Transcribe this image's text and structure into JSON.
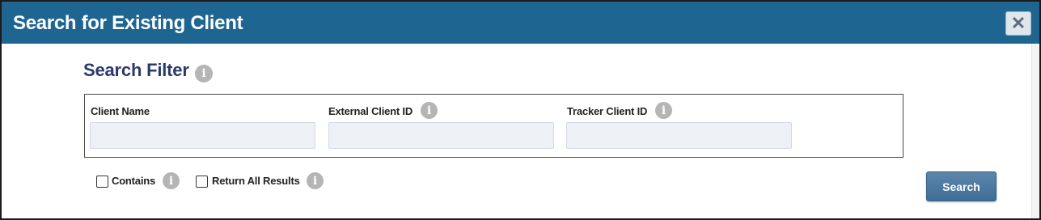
{
  "dialog": {
    "title": "Search for Existing Client",
    "close_symbol": "✕"
  },
  "filter": {
    "section_title": "Search Filter",
    "fields": [
      {
        "label": "Client Name",
        "value": "",
        "placeholder": ""
      },
      {
        "label": "External Client ID",
        "value": "",
        "placeholder": ""
      },
      {
        "label": "Tracker Client ID",
        "value": "",
        "placeholder": ""
      }
    ]
  },
  "options": {
    "contains_label": "Contains",
    "contains_checked": false,
    "return_all_label": "Return All Results",
    "return_all_checked": false
  },
  "actions": {
    "search_label": "Search"
  },
  "icons": {
    "info_glyph": "i"
  },
  "colors": {
    "titlebar": "#1f6591",
    "section_title": "#2c3a6b",
    "search_button": "#4a7aa3",
    "info_icon": "#b5b5b5"
  }
}
